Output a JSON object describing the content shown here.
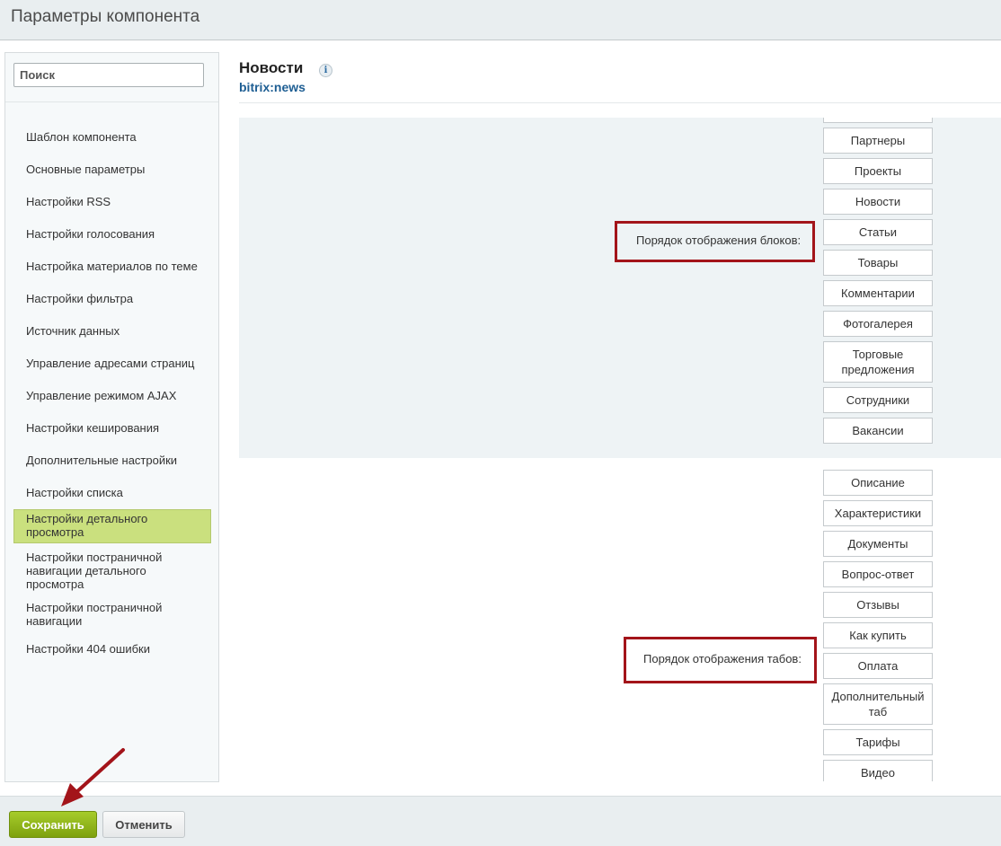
{
  "window": {
    "title": "Параметры компонента"
  },
  "sidebar": {
    "search_placeholder": "Поиск",
    "items": [
      {
        "label": "Шаблон компонента"
      },
      {
        "label": "Основные параметры"
      },
      {
        "label": "Настройки RSS"
      },
      {
        "label": "Настройки голосования"
      },
      {
        "label": "Настройка материалов по теме"
      },
      {
        "label": "Настройки фильтра"
      },
      {
        "label": "Источник данных"
      },
      {
        "label": "Управление адресами страниц"
      },
      {
        "label": "Управление режимом AJAX"
      },
      {
        "label": "Настройки кеширования"
      },
      {
        "label": "Дополнительные настройки"
      },
      {
        "label": "Настройки списка"
      },
      {
        "label": "Настройки детального просмотра",
        "active": true
      },
      {
        "label": "Настройки постраничной навигации детального просмотра"
      },
      {
        "label": "Настройки постраничной навигации"
      },
      {
        "label": "Настройки 404 ошибки"
      }
    ]
  },
  "header": {
    "title": "Новости",
    "info_icon": "info-icon",
    "subtitle": "bitrix:news"
  },
  "blocks_order": {
    "label": "Порядок отображения блоков:",
    "items": [
      "Партнеры",
      "Проекты",
      "Новости",
      "Статьи",
      "Товары",
      "Комментарии",
      "Фотогалерея",
      "Торговые предложения",
      "Сотрудники",
      "Вакансии"
    ]
  },
  "tabs_order": {
    "label": "Порядок отображения табов:",
    "items": [
      "Описание",
      "Характеристики",
      "Документы",
      "Вопрос-ответ",
      "Отзывы",
      "Как купить",
      "Оплата",
      "Дополнительный таб",
      "Тарифы",
      "Видео"
    ]
  },
  "footer": {
    "save_label": "Сохранить",
    "cancel_label": "Отменить"
  },
  "colors": {
    "annotation_red": "#a3141a",
    "active_item": "#cae07e",
    "save_button": "#8db31b",
    "link_blue": "#1e5e93"
  }
}
